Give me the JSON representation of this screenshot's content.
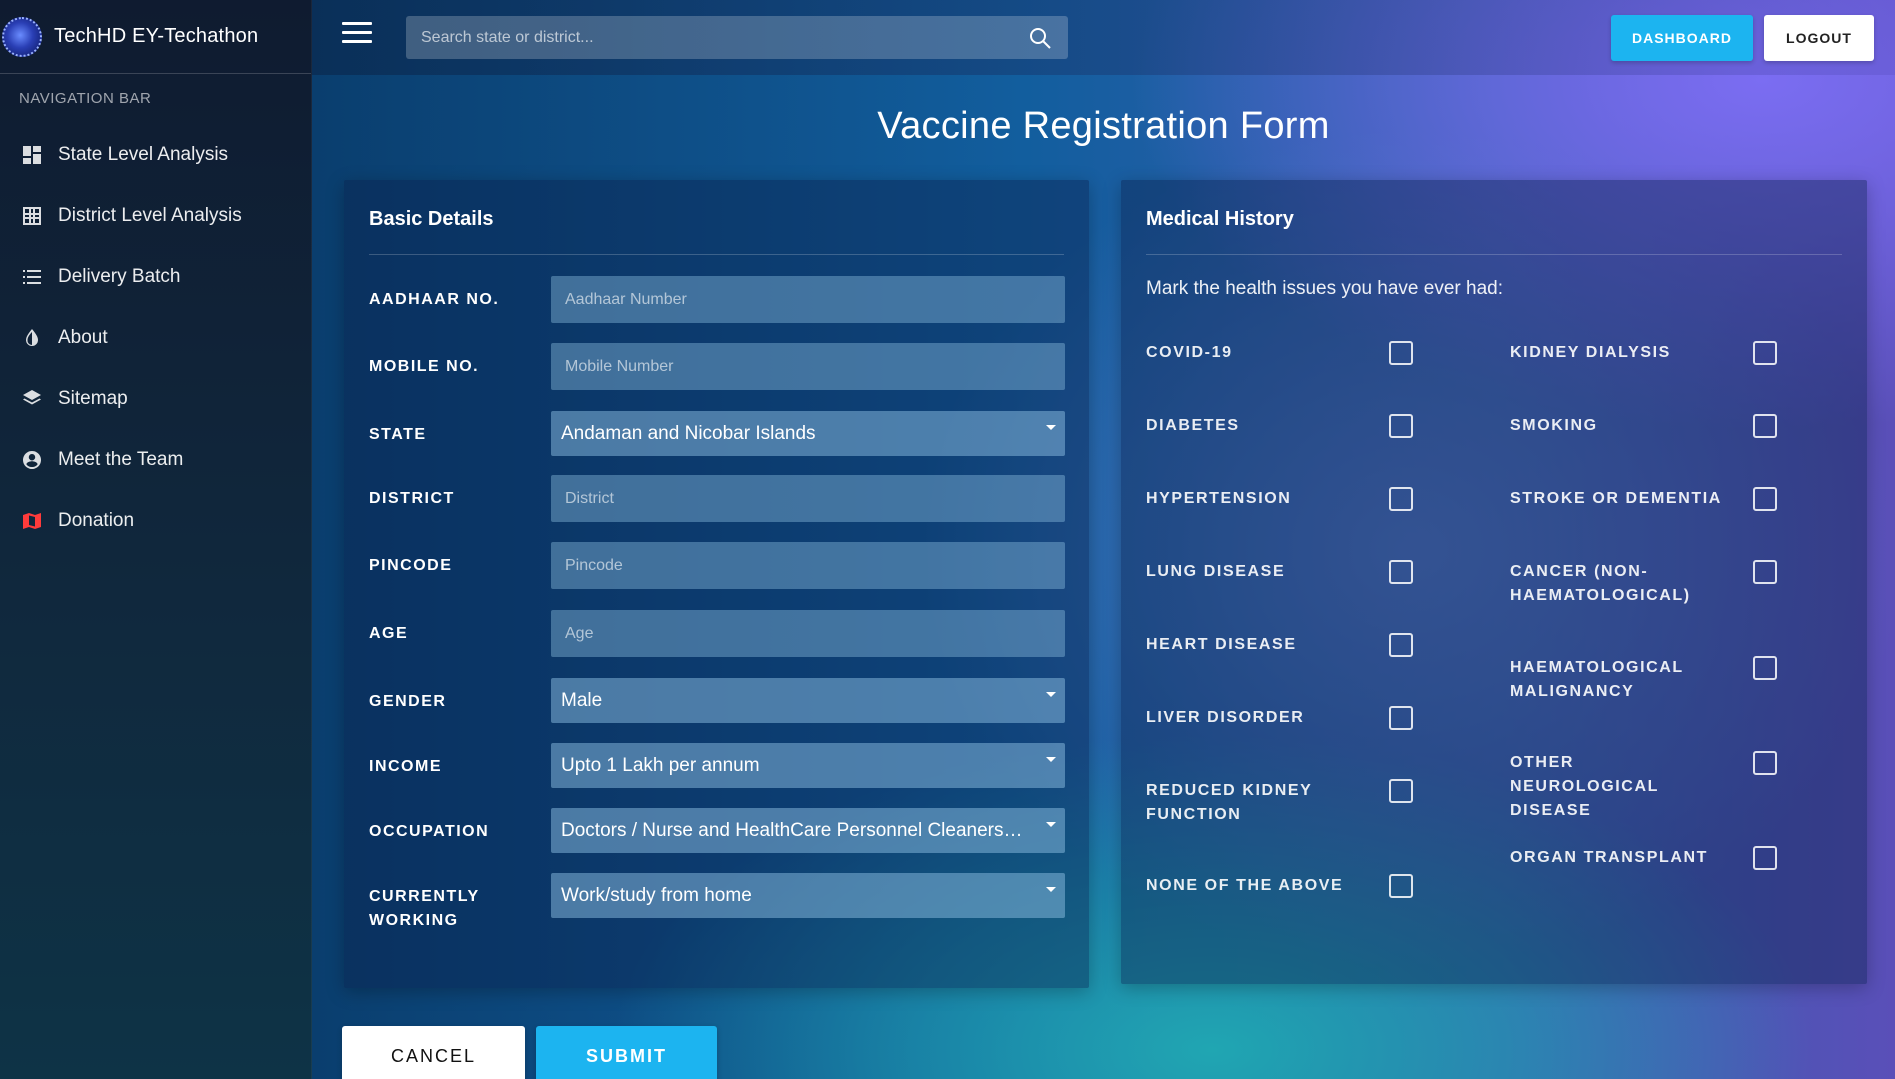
{
  "app": {
    "title": "TechHD EY-Techathon"
  },
  "sidebar": {
    "header": "NAVIGATION BAR",
    "items": [
      {
        "label": "State Level Analysis",
        "icon": "dashboard-icon"
      },
      {
        "label": "District Level Analysis",
        "icon": "grid-icon"
      },
      {
        "label": "Delivery Batch",
        "icon": "list-icon"
      },
      {
        "label": "About",
        "icon": "contrast-drop-icon"
      },
      {
        "label": "Sitemap",
        "icon": "layers-icon"
      },
      {
        "label": "Meet the Team",
        "icon": "user-circle-icon"
      },
      {
        "label": "Donation",
        "icon": "map-icon"
      }
    ]
  },
  "topbar": {
    "search_placeholder": "Search state or district...",
    "dashboard_label": "DASHBOARD",
    "logout_label": "LOGOUT"
  },
  "page": {
    "title": "Vaccine Registration Form"
  },
  "basic": {
    "title": "Basic Details",
    "fields": {
      "aadhaar": {
        "label": "AADHAAR NO.",
        "placeholder": "Aadhaar Number"
      },
      "mobile": {
        "label": "MOBILE NO.",
        "placeholder": "Mobile Number"
      },
      "state": {
        "label": "STATE",
        "value": "Andaman and Nicobar Islands"
      },
      "district": {
        "label": "DISTRICT",
        "placeholder": "District"
      },
      "pincode": {
        "label": "PINCODE",
        "placeholder": "Pincode"
      },
      "age": {
        "label": "AGE",
        "placeholder": "Age"
      },
      "gender": {
        "label": "GENDER",
        "value": "Male"
      },
      "income": {
        "label": "INCOME",
        "value": "Upto 1 Lakh per annum"
      },
      "occupation": {
        "label": "OCCUPATION",
        "value": "Doctors / Nurse and HealthCare Personnel Cleaners…"
      },
      "working": {
        "label": "CURRENTLY WORKING",
        "value": "Work/study from home"
      }
    }
  },
  "medical": {
    "title": "Medical History",
    "intro": "Mark the health issues you have ever had:",
    "left": [
      "COVID-19",
      "DIABETES",
      "HYPERTENSION",
      "LUNG DISEASE",
      "HEART DISEASE",
      "LIVER DISORDER",
      "REDUCED KIDNEY FUNCTION",
      "NONE OF THE ABOVE"
    ],
    "right": [
      "KIDNEY DIALYSIS",
      "SMOKING",
      "STROKE OR DEMENTIA",
      "CANCER (NON-HAEMATOLOGICAL)",
      "HAEMATOLOGICAL MALIGNANCY",
      "OTHER NEUROLOGICAL DISEASE",
      "ORGAN TRANSPLANT"
    ]
  },
  "actions": {
    "cancel_label": "CANCEL",
    "submit_label": "SUBMIT"
  },
  "colors": {
    "accent": "#1cb4f0",
    "sidebar_bg": "#0f1b30",
    "donation_icon": "#ff3b3b"
  }
}
